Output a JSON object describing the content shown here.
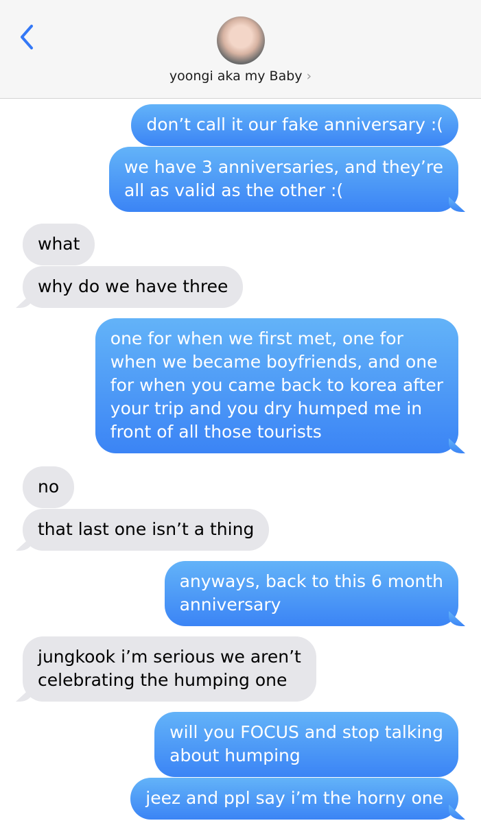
{
  "header": {
    "back_icon": "chevron-left-icon",
    "contact_name": "yoongi aka my Baby",
    "contact_chevron": "›",
    "accent": "#3478f6"
  },
  "messages": [
    {
      "from": "me",
      "lines": [
        "don’t call it our fake anniversary :("
      ]
    },
    {
      "from": "me",
      "lines": [
        "we have 3 anniversaries, and they’re",
        "all as valid as the other :("
      ]
    },
    {
      "from": "them",
      "lines": [
        "what"
      ]
    },
    {
      "from": "them",
      "lines": [
        "why do we have three"
      ]
    },
    {
      "from": "me",
      "lines": [
        "one for when we first met, one for",
        "when we became boyfriends, and one",
        "for when you came back to korea after",
        "your trip and you dry humped me in",
        "front of all those tourists"
      ]
    },
    {
      "from": "them",
      "lines": [
        "no"
      ]
    },
    {
      "from": "them",
      "lines": [
        "that last one isn’t a thing"
      ]
    },
    {
      "from": "me",
      "lines": [
        "anyways, back to this 6 month",
        "anniversary"
      ]
    },
    {
      "from": "them",
      "lines": [
        "jungkook i’m serious we aren’t",
        "celebrating the humping one"
      ]
    },
    {
      "from": "me",
      "lines": [
        "will you FOCUS and stop talking",
        "about humping"
      ]
    },
    {
      "from": "me",
      "lines": [
        "jeez and ppl say i’m the horny one"
      ]
    }
  ],
  "colors": {
    "sent_top": "#63b3f8",
    "sent_bottom": "#3b84f5",
    "received": "#e6e6ea"
  }
}
